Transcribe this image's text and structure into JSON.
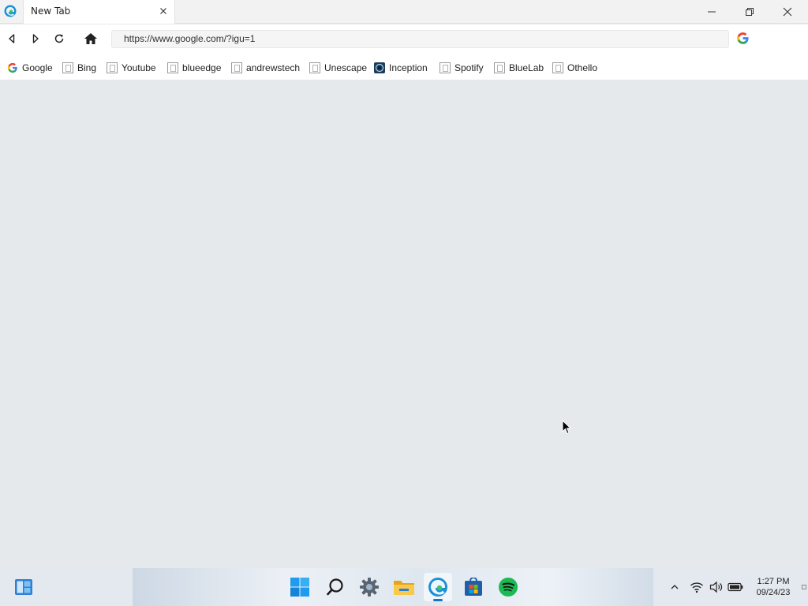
{
  "window": {
    "tab_title": "New Tab"
  },
  "navigation": {
    "address": "https://www.google.com/?igu=1"
  },
  "bookmarks": [
    {
      "label": "Google",
      "icon": "google-icon"
    },
    {
      "label": "Bing",
      "icon": "page-icon"
    },
    {
      "label": "Youtube",
      "icon": "page-icon"
    },
    {
      "label": "blueedge",
      "icon": "page-icon"
    },
    {
      "label": "andrewstech",
      "icon": "page-icon"
    },
    {
      "label": "Unescape",
      "icon": "page-icon"
    },
    {
      "label": "Inception",
      "icon": "inception-icon"
    },
    {
      "label": "Spotify",
      "icon": "page-icon"
    },
    {
      "label": "BlueLab",
      "icon": "page-icon"
    },
    {
      "label": "Othello",
      "icon": "page-icon"
    }
  ],
  "taskbar": {
    "apps": [
      "widgets",
      "start",
      "search",
      "settings",
      "file-explorer",
      "edge",
      "store",
      "spotify"
    ],
    "active_app": "edge",
    "clock_time": "1:27 PM",
    "clock_date": "09/24/23"
  },
  "colors": {
    "content_background": "#e6e9ec",
    "taskbar_accent": "#1a73c8",
    "spotify_green": "#1db954"
  }
}
